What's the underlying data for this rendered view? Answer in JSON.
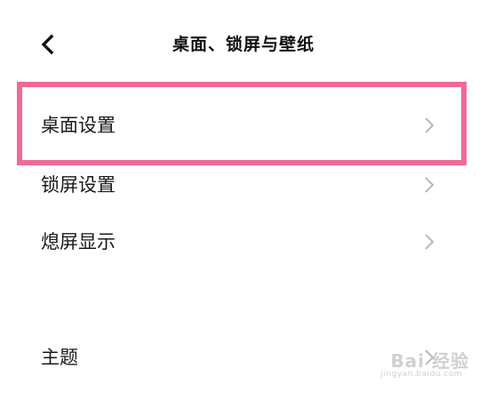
{
  "header": {
    "back_icon": "back-arrow-icon",
    "title": "桌面、锁屏与壁纸"
  },
  "settings": {
    "items": [
      {
        "label": "桌面设置",
        "icon": "chevron-right-icon",
        "highlighted": true
      },
      {
        "label": "锁屏设置",
        "icon": "chevron-right-icon"
      },
      {
        "label": "熄屏显示",
        "icon": "chevron-right-icon"
      },
      {
        "label": "主题",
        "icon": "chevron-right-icon"
      }
    ]
  },
  "annotation": {
    "highlight_color": "#ef6b93"
  },
  "watermark": {
    "brand": "Bai 经验",
    "url": "jingyan.baidu.com"
  }
}
